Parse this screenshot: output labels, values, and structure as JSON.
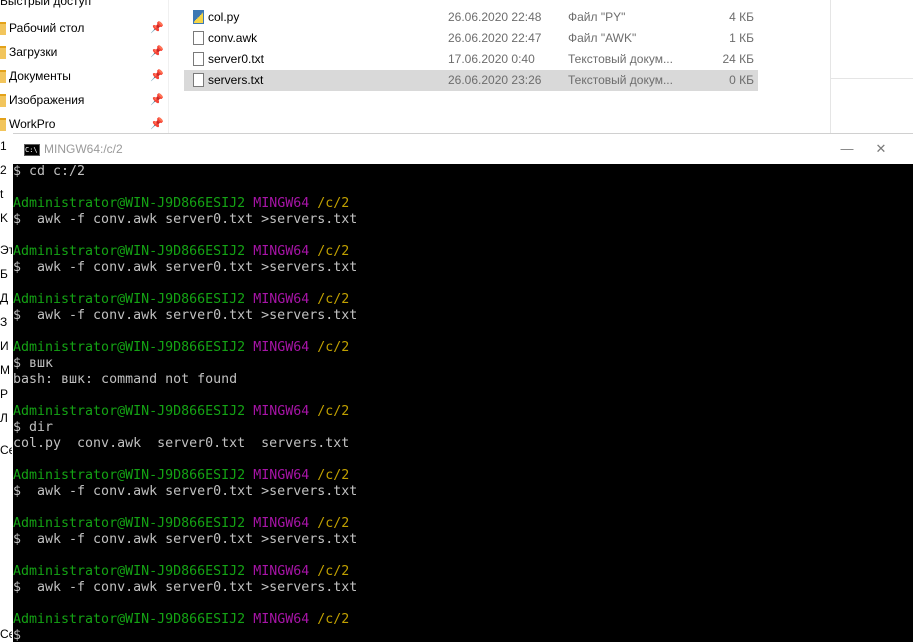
{
  "explorer": {
    "nav_header": "Быстрый доступ",
    "nav_items": [
      {
        "label": "Рабочий стол"
      },
      {
        "label": "Загрузки"
      },
      {
        "label": "Документы"
      },
      {
        "label": "Изображения"
      },
      {
        "label": "WorkPro"
      }
    ],
    "pin_glyph": "📌",
    "cut_items": [
      "1",
      "2",
      "t",
      "K",
      "Эт",
      "Б",
      "Д",
      "З",
      "И",
      "М",
      "Р",
      "Л",
      "Се",
      "Сет"
    ],
    "files": [
      {
        "name": "col.py",
        "date": "26.06.2020 22:48",
        "type": "Файл \"PY\"",
        "size": "4 КБ",
        "icon": "python-file-icon",
        "selected": false
      },
      {
        "name": "conv.awk",
        "date": "26.06.2020 22:47",
        "type": "Файл \"AWK\"",
        "size": "1 КБ",
        "icon": "file-icon",
        "selected": false
      },
      {
        "name": "server0.txt",
        "date": "17.06.2020 0:40",
        "type": "Текстовый докум...",
        "size": "24 КБ",
        "icon": "text-file-icon",
        "selected": false
      },
      {
        "name": "servers.txt",
        "date": "26.06.2020 23:26",
        "type": "Текстовый докум...",
        "size": "0 КБ",
        "icon": "text-file-icon",
        "selected": true
      }
    ]
  },
  "terminal": {
    "title": "MINGW64:/c/2",
    "icon_text": "C:\\",
    "minimize_glyph": "—",
    "close_glyph": "✕",
    "colors": {
      "user": "#14a314",
      "env": "#a714a7",
      "path": "#c0a000",
      "text": "#c0c0c0",
      "bg": "#000000"
    },
    "prompt": {
      "user": "Administrator@WIN-J9D866ESIJ2",
      "env": "MINGW64",
      "path": "/c/2"
    },
    "lines": [
      {
        "kind": "text",
        "text": "$ cd c:/2"
      },
      {
        "kind": "blank"
      },
      {
        "kind": "prompt"
      },
      {
        "kind": "text",
        "text": "$  awk -f conv.awk server0.txt >servers.txt"
      },
      {
        "kind": "blank"
      },
      {
        "kind": "prompt"
      },
      {
        "kind": "text",
        "text": "$  awk -f conv.awk server0.txt >servers.txt"
      },
      {
        "kind": "blank"
      },
      {
        "kind": "prompt"
      },
      {
        "kind": "text",
        "text": "$  awk -f conv.awk server0.txt >servers.txt"
      },
      {
        "kind": "blank"
      },
      {
        "kind": "prompt"
      },
      {
        "kind": "text",
        "text": "$ вшк"
      },
      {
        "kind": "text",
        "text": "bash: вшк: command not found"
      },
      {
        "kind": "blank"
      },
      {
        "kind": "prompt"
      },
      {
        "kind": "text",
        "text": "$ dir"
      },
      {
        "kind": "text",
        "text": "col.py  conv.awk  server0.txt  servers.txt"
      },
      {
        "kind": "blank"
      },
      {
        "kind": "prompt"
      },
      {
        "kind": "text",
        "text": "$  awk -f conv.awk server0.txt >servers.txt"
      },
      {
        "kind": "blank"
      },
      {
        "kind": "prompt"
      },
      {
        "kind": "text",
        "text": "$  awk -f conv.awk server0.txt >servers.txt"
      },
      {
        "kind": "blank"
      },
      {
        "kind": "prompt"
      },
      {
        "kind": "text",
        "text": "$  awk -f conv.awk server0.txt >servers.txt"
      },
      {
        "kind": "blank"
      },
      {
        "kind": "prompt"
      },
      {
        "kind": "text",
        "text": "$"
      }
    ]
  }
}
